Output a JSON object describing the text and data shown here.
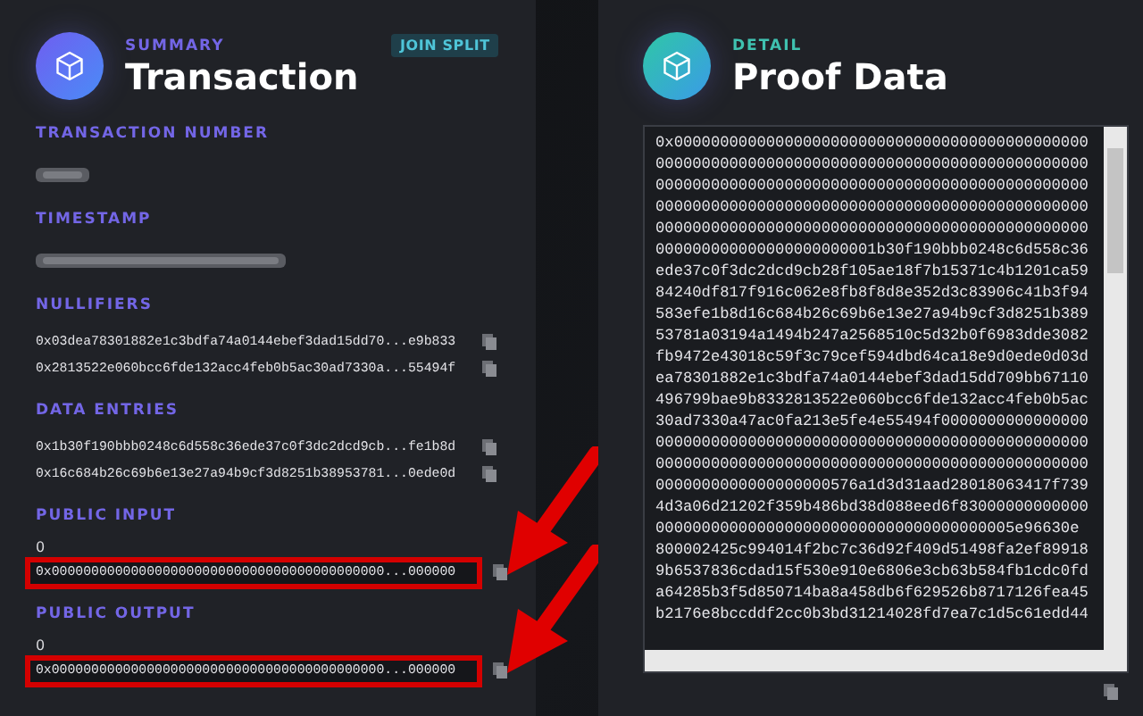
{
  "summary": {
    "eyebrow": "SUMMARY",
    "title": "Transaction",
    "badge": "JOIN SPLIT"
  },
  "sections": [
    {
      "kind": "redacted",
      "label": "TRANSACTION NUMBER"
    },
    {
      "kind": "redacted",
      "label": "TIMESTAMP"
    },
    {
      "kind": "hashes",
      "label": "NULLIFIERS",
      "values": [
        "0x03dea78301882e1c3bdfa74a0144ebef3dad15dd70...e9b833",
        "0x2813522e060bcc6fde132acc4feb0b5ac30ad7330a...55494f"
      ]
    },
    {
      "kind": "hashes",
      "label": "DATA ENTRIES",
      "values": [
        "0x1b30f190bbb0248c6d558c36ede37c0f3dc2dcd9cb...fe1b8d",
        "0x16c684b26c69b6e13e27a94b9cf3d8251b38953781...0ede0d"
      ]
    },
    {
      "kind": "field",
      "label": "PUBLIC INPUT",
      "amount": "0",
      "value": "0x000000000000000000000000000000000000000000...000000",
      "highlighted": true
    },
    {
      "kind": "field",
      "label": "PUBLIC OUTPUT",
      "amount": "0",
      "value": "0x000000000000000000000000000000000000000000...000000",
      "highlighted": true
    }
  ],
  "detail": {
    "eyebrow": "DETAIL",
    "title": "Proof Data",
    "lines": [
      "0x000000000000000000000000000000000000000000000",
      "00000000000000000000000000000000000000000000000",
      "00000000000000000000000000000000000000000000000",
      "00000000000000000000000000000000000000000000000",
      "00000000000000000000000000000000000000000000000",
      "000000000000000000000001b30f190bbb0248c6d558c36",
      "ede37c0f3dc2dcd9cb28f105ae18f7b15371c4b1201ca59",
      "84240df817f916c062e8fb8f8d8e352d3c83906c41b3f94",
      "583efe1b8d16c684b26c69b6e13e27a94b9cf3d8251b389",
      "53781a03194a1494b247a2568510c5d32b0f6983dde3082",
      "fb9472e43018c59f3c79cef594dbd64ca18e9d0ede0d03d",
      "ea78301882e1c3bdfa74a0144ebef3dad15dd709bb67110",
      "496799bae9b8332813522e060bcc6fde132acc4feb0b5ac",
      "30ad7330a47ac0fa213e5fe4e55494f0000000000000000",
      "00000000000000000000000000000000000000000000000",
      "00000000000000000000000000000000000000000000000",
      "0000000000000000000576a1d3d31aad28018063417f739",
      "4d3a06d21202f359b486bd38d088eed6f83000000000000",
      "000000000000000000000000000000000000005e96630e",
      "800002425c994014f2bc7c36d92f409d51498fa2ef89918",
      "9b6537836cdad15f530e910e6806e3cb63b584fb1cdc0fd",
      "a64285b3f5d850714ba8a458db6f629526b8717126fea45",
      "b2176e8bccddf2cc0b3bd31214028fd7ea7c1d5c61edd44"
    ]
  }
}
